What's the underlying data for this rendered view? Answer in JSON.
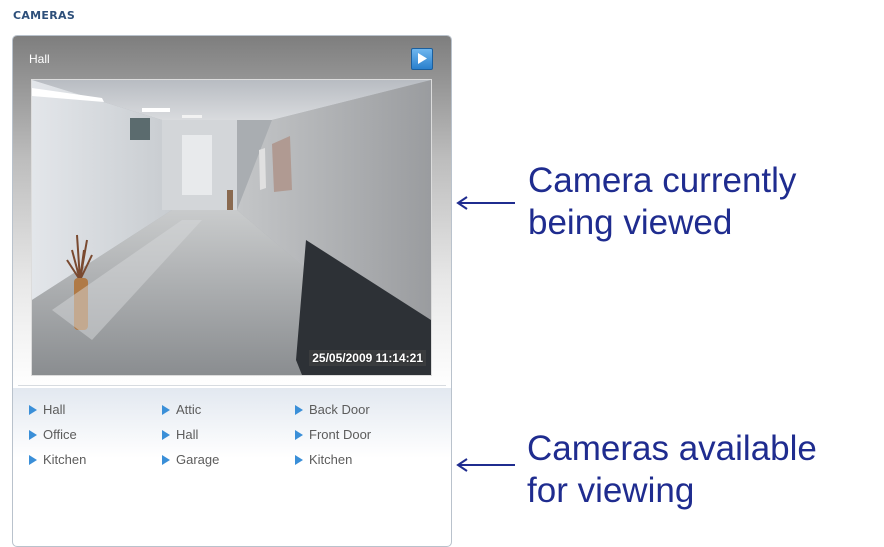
{
  "section": {
    "title": "CAMERAS"
  },
  "viewer": {
    "camera_name": "Hall",
    "play_icon": "play-icon",
    "timestamp": "25/05/2009 11:14:21"
  },
  "camera_list": {
    "items": [
      {
        "label": "Hall"
      },
      {
        "label": "Attic"
      },
      {
        "label": "Back Door"
      },
      {
        "label": "Office"
      },
      {
        "label": "Hall"
      },
      {
        "label": "Front Door"
      },
      {
        "label": "Kitchen"
      },
      {
        "label": "Garage"
      },
      {
        "label": "Kitchen"
      }
    ]
  },
  "annotations": {
    "current": {
      "line1": "Camera currently",
      "line2": "being viewed"
    },
    "available": {
      "line1": "Cameras available",
      "line2": "for viewing"
    }
  },
  "colors": {
    "accent": "#3a8fd8",
    "annotation": "#1f2c8f",
    "title": "#2d4f7a"
  }
}
